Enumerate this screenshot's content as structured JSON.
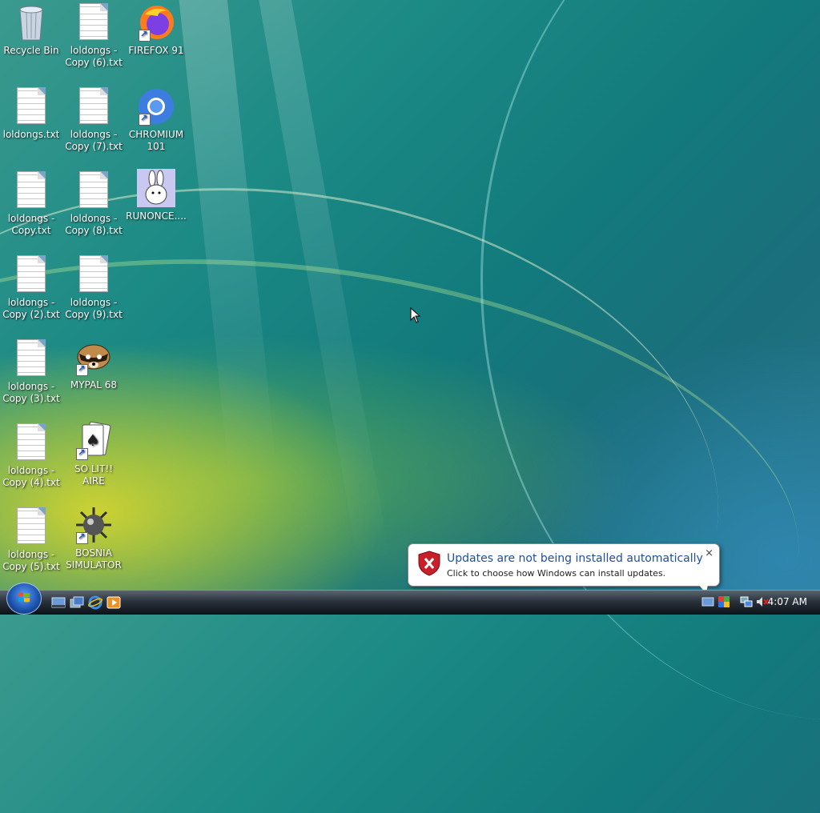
{
  "desktop": {
    "icons": [
      {
        "id": "recycle-bin",
        "label": "Recycle Bin"
      },
      {
        "id": "doc-6",
        "label": "loldongs - Copy (6).txt"
      },
      {
        "id": "firefox",
        "label": "FIREFOX 91"
      },
      {
        "id": "doc",
        "label": "loldongs.txt"
      },
      {
        "id": "doc-7",
        "label": "loldongs - Copy (7).txt"
      },
      {
        "id": "chromium",
        "label": "CHROMIUM 101"
      },
      {
        "id": "doc-copy",
        "label": "loldongs - Copy.txt"
      },
      {
        "id": "doc-8",
        "label": "loldongs - Copy (8).txt"
      },
      {
        "id": "runonce",
        "label": "RUNONCE...."
      },
      {
        "id": "doc-2",
        "label": "loldongs - Copy (2).txt"
      },
      {
        "id": "doc-9",
        "label": "loldongs - Copy (9).txt"
      },
      {
        "id": "doc-3",
        "label": "loldongs - Copy (3).txt"
      },
      {
        "id": "mypal",
        "label": "MYPAL 68"
      },
      {
        "id": "doc-4",
        "label": "loldongs - Copy (4).txt"
      },
      {
        "id": "solitaire",
        "label": "SO LIT!! AIRE"
      },
      {
        "id": "doc-5",
        "label": "loldongs - Copy (5).txt"
      },
      {
        "id": "minesweeper",
        "label": "BOSNIA SIMULATOR"
      }
    ]
  },
  "notification": {
    "title": "Updates are not being installed automatically",
    "body": "Click to choose how Windows can install updates.",
    "close": "×"
  },
  "taskbar": {
    "clock": "4:07 AM",
    "quick_launch": [
      "show-desktop-icon",
      "switch-windows-icon",
      "internet-explorer-icon",
      "media-player-icon"
    ],
    "tray_icons": [
      "windows-update-icon",
      "security-center-icon",
      "network-icon",
      "volume-muted-icon"
    ]
  },
  "colors": {
    "balloon_title": "#1e4fa0",
    "taskbar_top": "#5a6470",
    "taskbar_bottom": "#0d1218"
  }
}
